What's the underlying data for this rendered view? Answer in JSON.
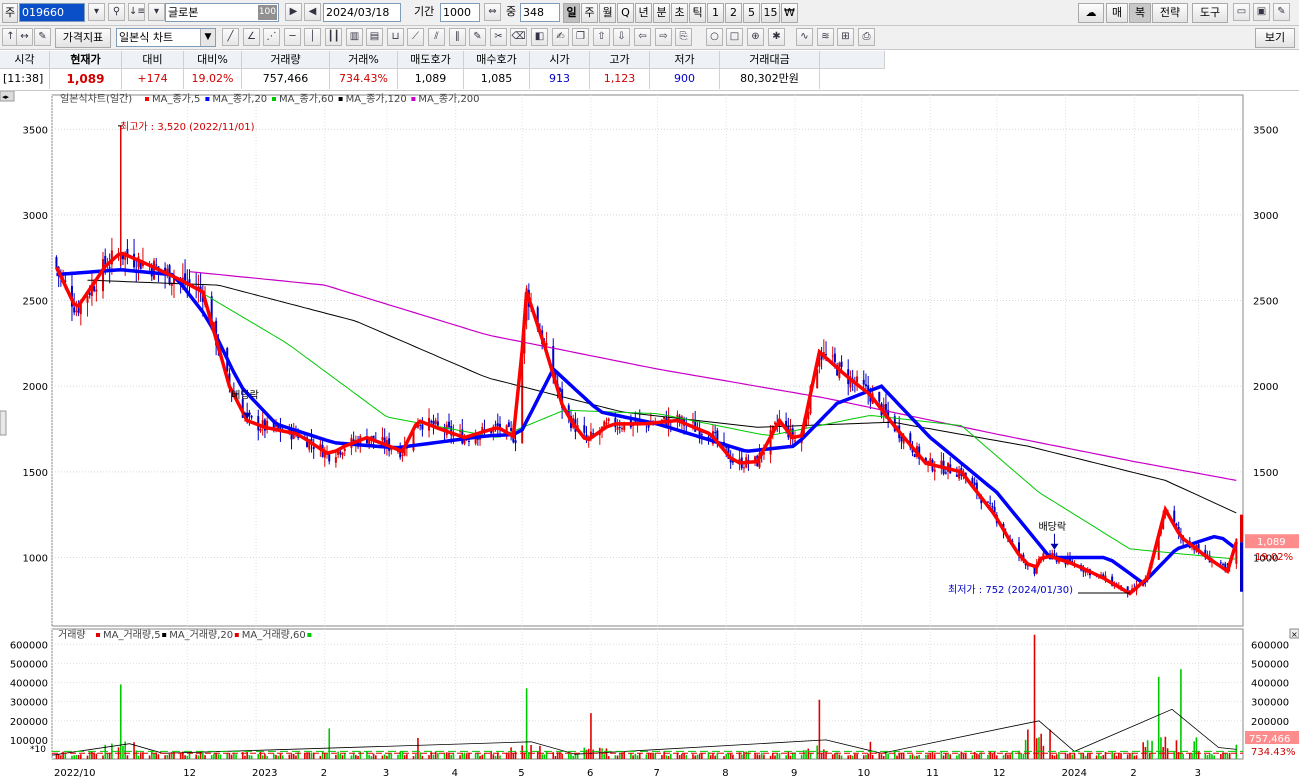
{
  "toolbar1": {
    "market_tab": "주",
    "code": "019660",
    "name": "글로본",
    "name_badge": "100",
    "date": "2024/03/18",
    "period_label": "기간",
    "period_value": "1000",
    "count_label": "중",
    "count_value": "348",
    "timeframes": [
      "일",
      "주",
      "월",
      "Q",
      "년",
      "분",
      "초",
      "틱",
      "1",
      "2",
      "5",
      "15",
      "₩"
    ],
    "active_timeframe": "일",
    "right_buttons": [
      "매",
      "복",
      "전략",
      "도구"
    ]
  },
  "toolbar2": {
    "indicator_button": "가격지표",
    "chart_type": "일본식 차트",
    "view_button": "보기"
  },
  "quote": {
    "headers": [
      "시각",
      "현재가",
      "대비",
      "대비%",
      "거래량",
      "거래%",
      "매도호가",
      "매수호가",
      "시가",
      "고가",
      "저가",
      "거래대금"
    ],
    "values": [
      "[11:38]",
      "1,089",
      "+174",
      "19.02%",
      "757,466",
      "734.43%",
      "1,089",
      "1,085",
      "913",
      "1,123",
      "900",
      "80,302만원"
    ]
  },
  "colors": {
    "up": "#e00000",
    "down": "#0000c8",
    "ma5": "#ff0000",
    "ma20": "#0000ff",
    "ma60": "#00c800",
    "ma120": "#000000",
    "ma200": "#c800c8"
  },
  "price_legend": {
    "title": "일본식차트(일간)",
    "items": [
      "MA_종가,5",
      "MA_종가,20",
      "MA_종가,60",
      "MA_종가,120",
      "MA_종가,200"
    ]
  },
  "volume_legend": {
    "title": "거래량",
    "items": [
      "MA_거래량,5",
      "MA_거래량,20",
      "MA_거래량,60"
    ]
  },
  "annotations": {
    "high": "최고가 : 3,520 (2022/11/01)",
    "low": "최저가 : 752 (2024/01/30)",
    "dividend": "배당락",
    "current_price": "1,089",
    "current_change": "19.02%",
    "current_volume": "757,466",
    "current_volume_pct": "734.43%",
    "volume_unit": "*10"
  },
  "chart_data": {
    "type": "candlestick",
    "price_axis": {
      "ticks": [
        3500,
        3000,
        2500,
        2000,
        1500,
        1000
      ],
      "range": [
        600,
        3700
      ]
    },
    "volume_axis": {
      "ticks": [
        600000,
        500000,
        400000,
        300000,
        200000,
        100000
      ],
      "range": [
        0,
        680000
      ]
    },
    "x_labels": [
      "2022/10",
      "12",
      "2023",
      "2",
      "3",
      "4",
      "5",
      "6",
      "7",
      "8",
      "9",
      "10",
      "11",
      "12",
      "2024",
      "2",
      "3"
    ],
    "close_path": [
      [
        "2022-10-01",
        2750
      ],
      [
        "2022-10-12",
        2450
      ],
      [
        "2022-10-25",
        2700
      ],
      [
        "2022-11-01",
        2780
      ],
      [
        "2022-11-15",
        2700
      ],
      [
        "2022-11-28",
        2620
      ],
      [
        "2022-12-08",
        2550
      ],
      [
        "2022-12-20",
        2000
      ],
      [
        "2022-12-28",
        1800
      ],
      [
        "2023-01-05",
        1760
      ],
      [
        "2023-01-20",
        1720
      ],
      [
        "2023-02-03",
        1600
      ],
      [
        "2023-02-10",
        1650
      ],
      [
        "2023-02-20",
        1700
      ],
      [
        "2023-03-02",
        1650
      ],
      [
        "2023-03-08",
        1620
      ],
      [
        "2023-03-15",
        1800
      ],
      [
        "2023-03-25",
        1750
      ],
      [
        "2023-04-05",
        1700
      ],
      [
        "2023-04-20",
        1760
      ],
      [
        "2023-04-28",
        1700
      ],
      [
        "2023-05-03",
        2550
      ],
      [
        "2023-05-12",
        2200
      ],
      [
        "2023-05-20",
        1850
      ],
      [
        "2023-05-30",
        1680
      ],
      [
        "2023-06-10",
        1780
      ],
      [
        "2023-06-25",
        1780
      ],
      [
        "2023-07-10",
        1800
      ],
      [
        "2023-07-25",
        1720
      ],
      [
        "2023-08-05",
        1550
      ],
      [
        "2023-08-15",
        1560
      ],
      [
        "2023-08-25",
        1800
      ],
      [
        "2023-09-03",
        1650
      ],
      [
        "2023-09-12",
        2200
      ],
      [
        "2023-09-25",
        2050
      ],
      [
        "2023-10-05",
        1950
      ],
      [
        "2023-10-15",
        1780
      ],
      [
        "2023-10-30",
        1550
      ],
      [
        "2023-11-15",
        1500
      ],
      [
        "2023-11-30",
        1250
      ],
      [
        "2023-12-10",
        1030
      ],
      [
        "2023-12-18",
        920
      ],
      [
        "2023-12-22",
        1020
      ],
      [
        "2024-01-05",
        960
      ],
      [
        "2024-01-18",
        880
      ],
      [
        "2024-01-30",
        790
      ],
      [
        "2024-02-07",
        880
      ],
      [
        "2024-02-15",
        1280
      ],
      [
        "2024-02-22",
        1120
      ],
      [
        "2024-03-05",
        1000
      ],
      [
        "2024-03-14",
        920
      ],
      [
        "2024-03-18",
        1089
      ]
    ],
    "ma20_path": [
      [
        "2022-10-01",
        2650
      ],
      [
        "2022-11-01",
        2680
      ],
      [
        "2022-11-25",
        2650
      ],
      [
        "2022-12-10",
        2400
      ],
      [
        "2022-12-25",
        2000
      ],
      [
        "2023-01-10",
        1780
      ],
      [
        "2023-02-05",
        1670
      ],
      [
        "2023-03-05",
        1640
      ],
      [
        "2023-04-15",
        1710
      ],
      [
        "2023-04-30",
        1720
      ],
      [
        "2023-05-15",
        2100
      ],
      [
        "2023-06-05",
        1850
      ],
      [
        "2023-07-01",
        1780
      ],
      [
        "2023-08-10",
        1620
      ],
      [
        "2023-09-01",
        1650
      ],
      [
        "2023-09-20",
        1900
      ],
      [
        "2023-10-10",
        2000
      ],
      [
        "2023-11-01",
        1700
      ],
      [
        "2023-12-01",
        1380
      ],
      [
        "2023-12-25",
        1000
      ],
      [
        "2024-01-20",
        1000
      ],
      [
        "2024-02-05",
        850
      ],
      [
        "2024-02-20",
        1050
      ],
      [
        "2024-03-10",
        1130
      ],
      [
        "2024-03-18",
        1050
      ]
    ],
    "ma60_path": [
      [
        "2022-11-20",
        2680
      ],
      [
        "2023-01-15",
        2250
      ],
      [
        "2023-03-01",
        1820
      ],
      [
        "2023-04-20",
        1700
      ],
      [
        "2023-05-20",
        1860
      ],
      [
        "2023-07-01",
        1840
      ],
      [
        "2023-08-20",
        1710
      ],
      [
        "2023-10-05",
        1830
      ],
      [
        "2023-11-15",
        1770
      ],
      [
        "2023-12-20",
        1380
      ],
      [
        "2024-01-30",
        1050
      ],
      [
        "2024-03-18",
        990
      ]
    ],
    "ma120_path": [
      [
        "2022-10-15",
        2620
      ],
      [
        "2022-12-15",
        2590
      ],
      [
        "2023-02-15",
        2380
      ],
      [
        "2023-04-15",
        2050
      ],
      [
        "2023-06-15",
        1850
      ],
      [
        "2023-08-15",
        1760
      ],
      [
        "2023-10-15",
        1790
      ],
      [
        "2023-12-15",
        1650
      ],
      [
        "2024-02-15",
        1450
      ],
      [
        "2024-03-18",
        1260
      ]
    ],
    "ma200_path": [
      [
        "2022-12-01",
        2670
      ],
      [
        "2023-02-01",
        2590
      ],
      [
        "2023-04-15",
        2300
      ],
      [
        "2023-07-01",
        2100
      ],
      [
        "2023-09-15",
        1930
      ],
      [
        "2023-12-01",
        1720
      ],
      [
        "2024-02-01",
        1560
      ],
      [
        "2024-03-18",
        1450
      ]
    ],
    "high_point": [
      "2022-11-01",
      3520
    ],
    "low_point": [
      "2024-01-30",
      752
    ],
    "volume_spikes": [
      [
        "2022-11-01",
        390000
      ],
      [
        "2023-02-03",
        160000
      ],
      [
        "2023-03-15",
        110000
      ],
      [
        "2023-05-03",
        370000
      ],
      [
        "2023-06-01",
        240000
      ],
      [
        "2023-09-12",
        310000
      ],
      [
        "2023-10-05",
        90000
      ],
      [
        "2023-12-18",
        650000
      ],
      [
        "2024-02-12",
        430000
      ],
      [
        "2024-02-18",
        480000
      ],
      [
        "2024-02-22",
        470000
      ],
      [
        "2024-03-18",
        75000
      ]
    ]
  }
}
